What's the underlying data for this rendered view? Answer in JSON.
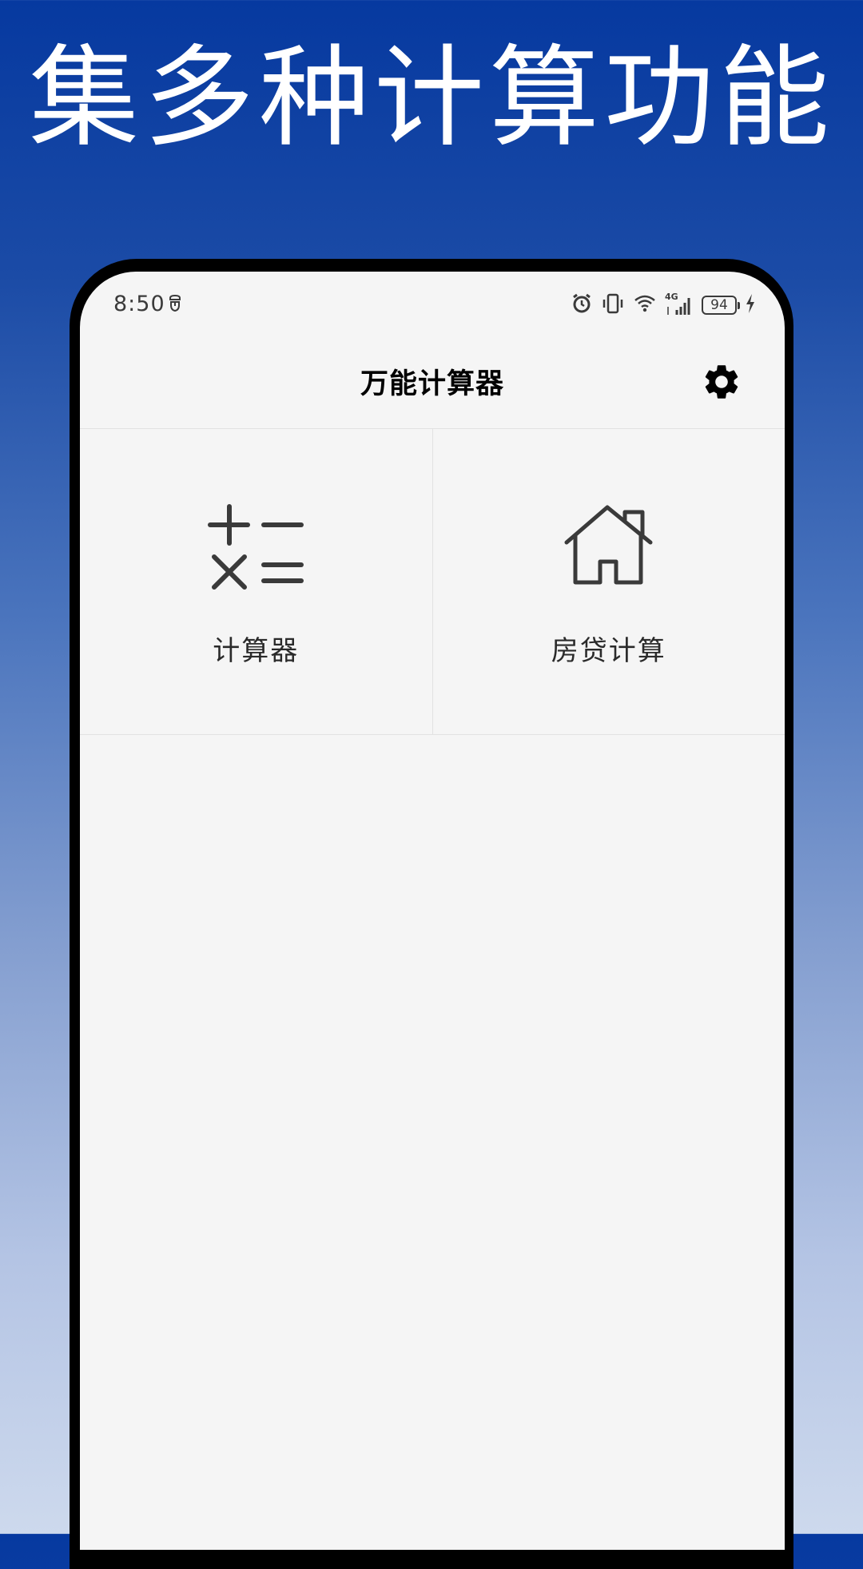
{
  "promo": {
    "headline": "集多种计算功能"
  },
  "status_bar": {
    "time": "8:50",
    "battery_level": "94",
    "network_label": "4G",
    "icons": [
      "notification-icon",
      "alarm-icon",
      "vibrate-icon",
      "wifi-icon",
      "signal-icon",
      "battery-icon",
      "charging-icon"
    ]
  },
  "app_bar": {
    "title": "万能计算器",
    "settings_icon": "gear-icon"
  },
  "tools": [
    {
      "label": "计算器",
      "icon": "calculator-icon"
    },
    {
      "label": "房贷计算",
      "icon": "house-icon"
    }
  ],
  "colors": {
    "gradient_top": "#0639a0",
    "gradient_bottom": "#cdd9ed",
    "screen_background": "#f5f5f5",
    "frame": "#000000",
    "icon_dark": "#3a3a3a"
  }
}
